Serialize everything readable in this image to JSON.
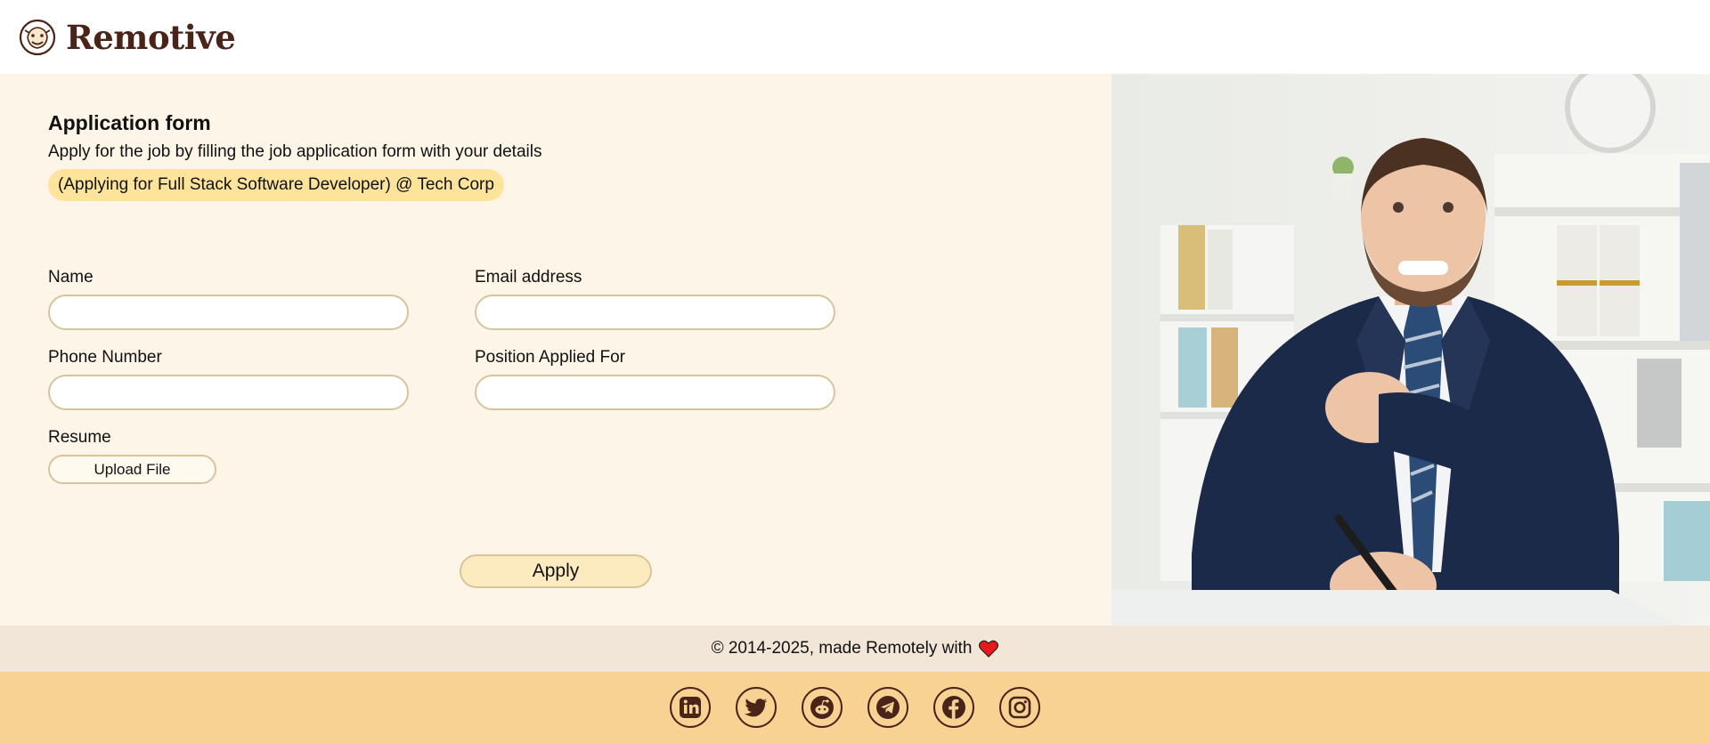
{
  "brand": {
    "name": "Remotive"
  },
  "form": {
    "title": "Application form",
    "subtitle": "Apply for the job by filling the job application form with your details",
    "job_tag": "(Applying for Full Stack Software Developer) @ Tech Corp",
    "fields": {
      "name": {
        "label": "Name",
        "value": ""
      },
      "email": {
        "label": "Email address",
        "value": ""
      },
      "phone": {
        "label": "Phone Number",
        "value": ""
      },
      "position": {
        "label": "Position Applied For",
        "value": ""
      }
    },
    "resume": {
      "label": "Resume",
      "button": "Upload File"
    },
    "apply_label": "Apply"
  },
  "footer": {
    "copyright": "© 2014-2025, made Remotely with",
    "heart_icon": "heart-icon",
    "social": [
      "linkedin-icon",
      "twitter-icon",
      "reddit-icon",
      "telegram-icon",
      "facebook-icon",
      "instagram-icon"
    ]
  },
  "colors": {
    "brand": "#4a2418",
    "form_bg": "#fdf5e7",
    "tag_bg": "#fde49a",
    "social_bg": "#f8d293",
    "copyright_bg": "#f1e6d8"
  }
}
